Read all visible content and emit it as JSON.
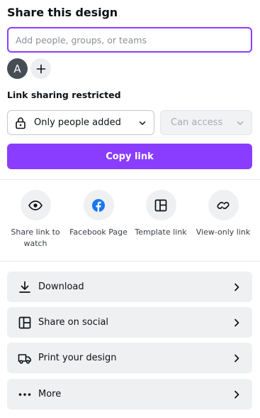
{
  "header": {
    "title": "Share this design"
  },
  "people": {
    "input_placeholder": "Add people, groups, or teams",
    "avatar_initial": "A"
  },
  "link_sharing": {
    "label": "Link sharing restricted",
    "access_value": "Only people added",
    "permission_value": "Can access",
    "copy_button": "Copy link"
  },
  "share_options": [
    {
      "label": "Share link to watch",
      "icon": "eye-icon"
    },
    {
      "label": "Facebook Page",
      "icon": "facebook-icon"
    },
    {
      "label": "Template link",
      "icon": "template-icon"
    },
    {
      "label": "View-only link",
      "icon": "link-icon"
    }
  ],
  "actions": [
    {
      "label": "Download",
      "icon": "download-icon"
    },
    {
      "label": "Share on social",
      "icon": "social-icon"
    },
    {
      "label": "Print your design",
      "icon": "truck-icon"
    },
    {
      "label": "More",
      "icon": "more-icon"
    }
  ],
  "colors": {
    "accent": "#8b3dff",
    "facebook": "#1877f2",
    "row_bg": "#eff0f2"
  }
}
